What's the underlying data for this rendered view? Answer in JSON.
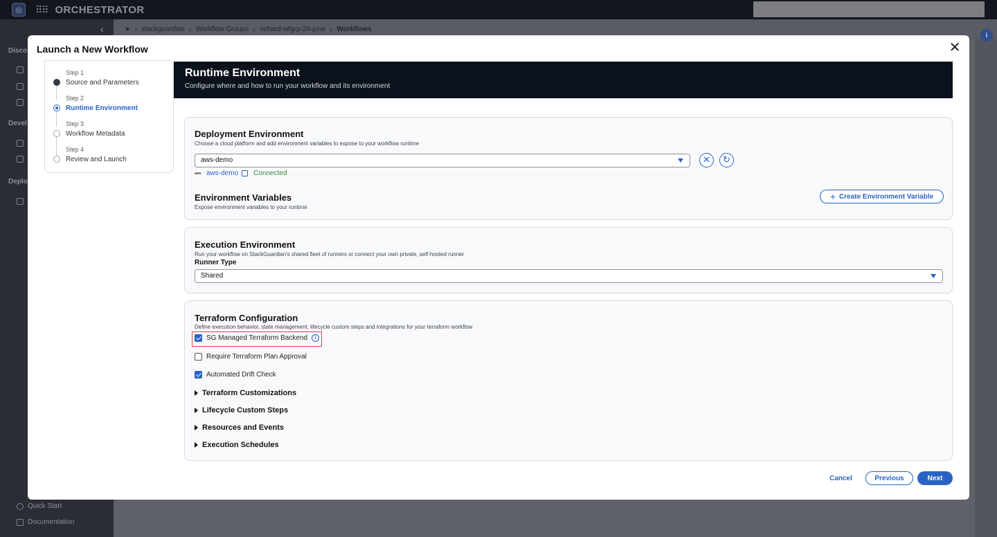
{
  "app": {
    "brand": "ORCHESTRATOR"
  },
  "sidebar": {
    "sections": [
      "Disco",
      "Devel",
      "Deplo"
    ],
    "bottom_items": [
      {
        "label": "Quick Start",
        "icon": "power-icon"
      },
      {
        "label": "Documentation",
        "icon": "book-icon"
      }
    ]
  },
  "breadcrumb": {
    "items": [
      "stackguardian",
      "Workflow Groups",
      "richard-wfgrp-24-june",
      "Workflows"
    ]
  },
  "modal": {
    "title": "Launch a New Workflow",
    "steps": [
      {
        "num": "Step 1",
        "label": "Source and Parameters",
        "state": "done"
      },
      {
        "num": "Step 2",
        "label": "Runtime Environment",
        "state": "active"
      },
      {
        "num": "Step 3",
        "label": "Workflow Metadata",
        "state": "pending"
      },
      {
        "num": "Step 4",
        "label": "Review and Launch",
        "state": "pending"
      }
    ],
    "header": {
      "title": "Runtime Environment",
      "subtitle": "Configure where and how to run your workflow and its environment"
    },
    "deployment": {
      "title": "Deployment Environment",
      "subtitle": "Choose a cloud platform and add environment variables to expose to your workflow runtime",
      "selected": "aws-demo",
      "link_label": "aws-demo",
      "aws_logo": "aws",
      "status": "Connected"
    },
    "env_vars": {
      "title": "Environment Variables",
      "subtitle": "Expose environment variables to your runtime",
      "create_button": "Create Environment Variable"
    },
    "execution": {
      "title": "Execution Environment",
      "subtitle": "Run your workflow on StackGuardian's shared fleet of runners or connect your own private, self-hosted runner",
      "runner_label": "Runner Type",
      "runner_value": "Shared"
    },
    "terraform": {
      "title": "Terraform Configuration",
      "subtitle": "Define execution behavior, state management, lifecycle custom steps and integrations for your terraform workflow",
      "options": [
        {
          "label": "SG Managed Terraform Backend",
          "checked": true
        },
        {
          "label": "Require Terraform Plan Approval",
          "checked": false
        },
        {
          "label": "Automated Drift Check",
          "checked": true
        }
      ],
      "sections": [
        "Terraform Customizations",
        "Lifecycle Custom Steps",
        "Resources and Events",
        "Execution Schedules"
      ]
    },
    "footer": {
      "cancel": "Cancel",
      "previous": "Previous",
      "next": "Next"
    }
  },
  "colors": {
    "accent": "#2a63c4",
    "banner_bg": "#0c121c",
    "success": "#2e8b3a",
    "highlight_border": "#e0434e"
  }
}
